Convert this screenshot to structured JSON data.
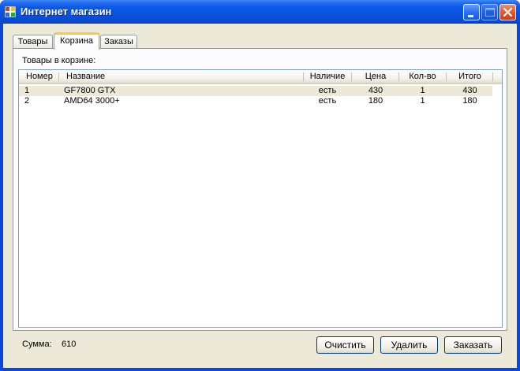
{
  "window": {
    "title": "Интернет магазин"
  },
  "tabs": [
    {
      "label": "Товары"
    },
    {
      "label": "Корзина"
    },
    {
      "label": "Заказы"
    }
  ],
  "cart": {
    "label": "Товары в корзине:",
    "columns": [
      "Номер",
      "Название",
      "Наличие",
      "Цена",
      "Кол-во",
      "Итого"
    ],
    "rows": [
      [
        "1",
        "GF7800 GTX",
        "есть",
        "430",
        "1",
        "430"
      ],
      [
        "2",
        "AMD64 3000+",
        "есть",
        "180",
        "1",
        "180"
      ]
    ]
  },
  "summary": {
    "label": "Сумма:",
    "value": "610"
  },
  "buttons": {
    "clear": "Очистить",
    "delete": "Удалить",
    "order": "Заказать"
  },
  "colors": {
    "title_bar": "#0a52dc",
    "client": "#ece9d8",
    "active_tab_accent": "#ffc83c",
    "close_button": "#e05a30"
  }
}
